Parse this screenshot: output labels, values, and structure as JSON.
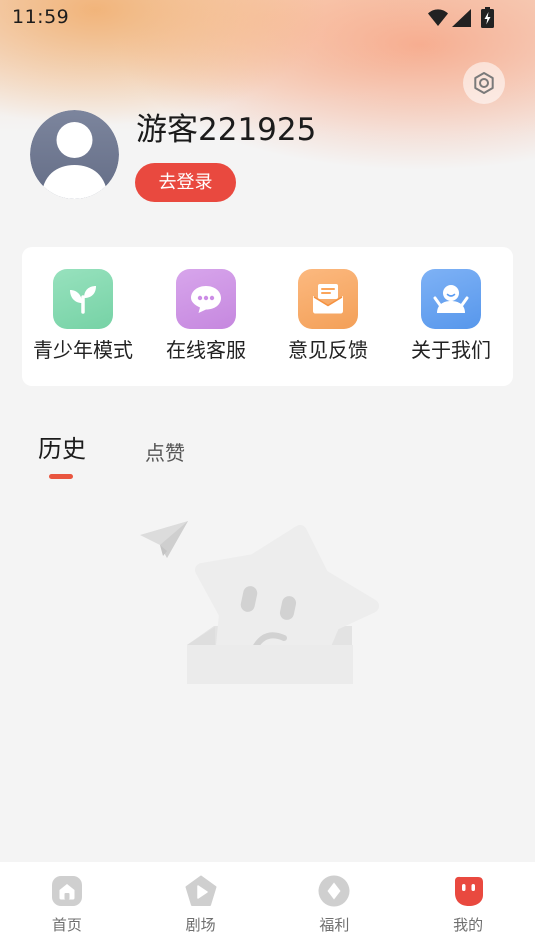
{
  "status_bar": {
    "time": "11:59",
    "icons": [
      "wifi-icon",
      "cellular-signal-icon",
      "battery-charging-icon"
    ]
  },
  "header": {
    "settings_icon": "settings-hexagon-icon"
  },
  "profile": {
    "avatar_icon": "default-avatar-icon",
    "username": "游客221925",
    "login_label": "去登录"
  },
  "quick_actions": [
    {
      "label": "青少年模式",
      "icon": "sprout-icon",
      "color": "#7ad9ab"
    },
    {
      "label": "在线客服",
      "icon": "chat-bubble-icon",
      "color": "#cc8ce6"
    },
    {
      "label": "意见反馈",
      "icon": "envelope-icon",
      "color": "#fba55b"
    },
    {
      "label": "关于我们",
      "icon": "about-person-icon",
      "color": "#5a9cf3"
    }
  ],
  "tabs": [
    {
      "label": "历史",
      "active": true
    },
    {
      "label": "点赞",
      "active": false
    }
  ],
  "empty_state": {
    "illustration": "empty-box-star-illustration"
  },
  "bottom_nav": [
    {
      "label": "首页",
      "icon": "home-icon",
      "active": false
    },
    {
      "label": "剧场",
      "icon": "theater-play-icon",
      "active": false
    },
    {
      "label": "福利",
      "icon": "welfare-diamond-icon",
      "active": false
    },
    {
      "label": "我的",
      "icon": "profile-face-icon",
      "active": true
    }
  ],
  "colors": {
    "accent": "#e9493f",
    "tab_indicator": "#e9553f",
    "nav_inactive_icon": "#cfcfcf",
    "page_background": "#f4f4f4"
  }
}
